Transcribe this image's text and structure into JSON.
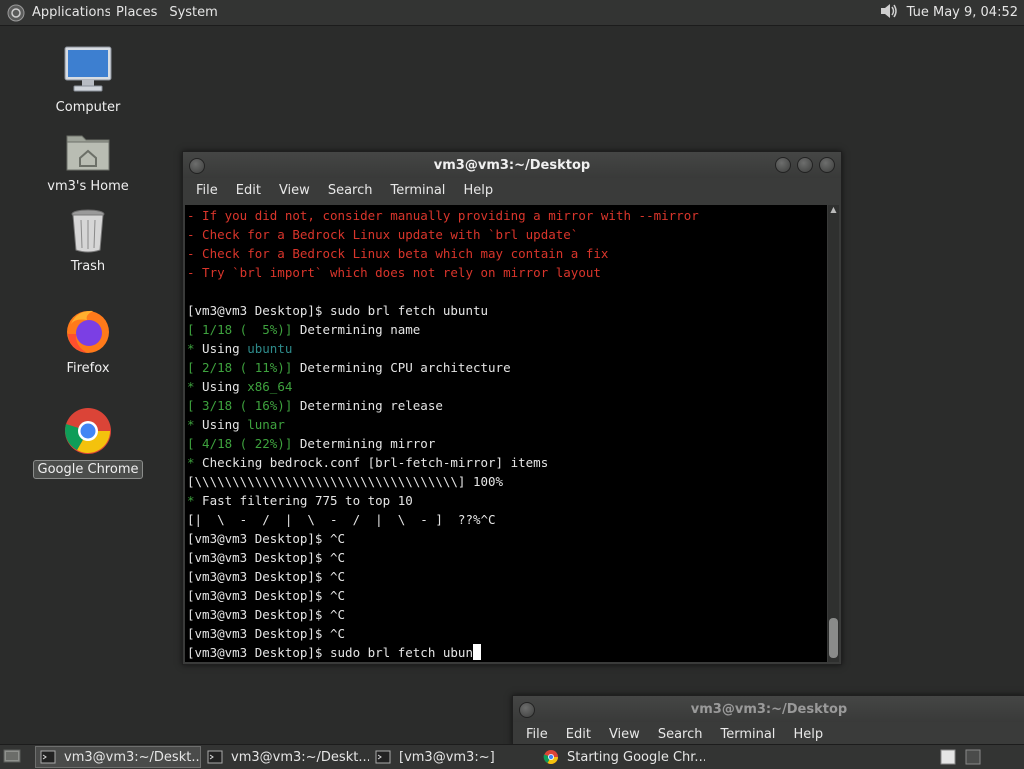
{
  "top_panel": {
    "menus": [
      "Applications",
      "Places",
      "System"
    ],
    "clock": "Tue May  9, 04:52"
  },
  "desktop": {
    "icons": [
      {
        "label": "Computer",
        "icon": "computer-icon"
      },
      {
        "label": "vm3's Home",
        "icon": "home-folder-icon"
      },
      {
        "label": "Trash",
        "icon": "trash-icon"
      },
      {
        "label": "Firefox",
        "icon": "firefox-icon"
      },
      {
        "label": "Google Chrome",
        "icon": "chrome-icon",
        "selected": true
      }
    ]
  },
  "terminal": {
    "title": "vm3@vm3:~/Desktop",
    "menu": [
      "File",
      "Edit",
      "View",
      "Search",
      "Terminal",
      "Help"
    ],
    "lines": [
      [
        {
          "c": "red",
          "t": "- If you did not, consider manually providing a mirror with --mirror"
        }
      ],
      [
        {
          "c": "red",
          "t": "- Check for a Bedrock Linux update with `brl update`"
        }
      ],
      [
        {
          "c": "red",
          "t": "- Check for a Bedrock Linux beta which may contain a fix"
        }
      ],
      [
        {
          "c": "red",
          "t": "- Try `brl import` which does not rely on mirror layout"
        }
      ],
      [
        {
          "c": "white",
          "t": ""
        }
      ],
      [
        {
          "c": "white",
          "t": "[vm3@vm3 Desktop]$ sudo brl fetch ubuntu"
        }
      ],
      [
        {
          "c": "green",
          "t": "[ 1/18 (  5%)]"
        },
        {
          "c": "white",
          "t": " Determining name"
        }
      ],
      [
        {
          "c": "green",
          "t": "*"
        },
        {
          "c": "white",
          "t": " Using "
        },
        {
          "c": "cyan",
          "t": "ubuntu"
        }
      ],
      [
        {
          "c": "green",
          "t": "[ 2/18 ( 11%)]"
        },
        {
          "c": "white",
          "t": " Determining CPU architecture"
        }
      ],
      [
        {
          "c": "green",
          "t": "*"
        },
        {
          "c": "white",
          "t": " Using "
        },
        {
          "c": "green",
          "t": "x86_64"
        }
      ],
      [
        {
          "c": "green",
          "t": "[ 3/18 ( 16%)]"
        },
        {
          "c": "white",
          "t": " Determining release"
        }
      ],
      [
        {
          "c": "green",
          "t": "*"
        },
        {
          "c": "white",
          "t": " Using "
        },
        {
          "c": "green",
          "t": "lunar"
        }
      ],
      [
        {
          "c": "green",
          "t": "[ 4/18 ( 22%)]"
        },
        {
          "c": "white",
          "t": " Determining mirror"
        }
      ],
      [
        {
          "c": "green",
          "t": "*"
        },
        {
          "c": "white",
          "t": " Checking bedrock.conf [brl-fetch-mirror] items"
        }
      ],
      [
        {
          "c": "white",
          "t": "[\\\\\\\\\\\\\\\\\\\\\\\\\\\\\\\\\\\\\\\\\\\\\\\\\\\\\\\\\\\\\\\\\\\\\\] 100%"
        }
      ],
      [
        {
          "c": "green",
          "t": "*"
        },
        {
          "c": "white",
          "t": " Fast filtering 775 to top 10"
        }
      ],
      [
        {
          "c": "white",
          "t": "[|  \\  -  /  |  \\  -  /  |  \\  - ]  ??%^C"
        }
      ],
      [
        {
          "c": "white",
          "t": "[vm3@vm3 Desktop]$ ^C"
        }
      ],
      [
        {
          "c": "white",
          "t": "[vm3@vm3 Desktop]$ ^C"
        }
      ],
      [
        {
          "c": "white",
          "t": "[vm3@vm3 Desktop]$ ^C"
        }
      ],
      [
        {
          "c": "white",
          "t": "[vm3@vm3 Desktop]$ ^C"
        }
      ],
      [
        {
          "c": "white",
          "t": "[vm3@vm3 Desktop]$ ^C"
        }
      ],
      [
        {
          "c": "white",
          "t": "[vm3@vm3 Desktop]$ ^C"
        }
      ],
      [
        {
          "c": "white",
          "t": "[vm3@vm3 Desktop]$ sudo brl fetch ubun"
        }
      ]
    ]
  },
  "background_window": {
    "title": "vm3@vm3:~/Desktop",
    "menu": [
      "File",
      "Edit",
      "View",
      "Search",
      "Terminal",
      "Help"
    ]
  },
  "taskbar": {
    "tasks": [
      {
        "label": "vm3@vm3:~/Deskt...",
        "icon": "terminal-icon",
        "active": true
      },
      {
        "label": "vm3@vm3:~/Deskt...",
        "icon": "terminal-icon",
        "active": false
      },
      {
        "label": "[vm3@vm3:~]",
        "icon": "terminal-icon",
        "active": false
      },
      {
        "label": "Starting Google Chr...",
        "icon": "chrome-icon",
        "active": false
      }
    ]
  },
  "colors": {
    "prompt_red": "#d9352b",
    "progress_green": "#3ea23e",
    "value_cyan": "#2e8b8b"
  }
}
